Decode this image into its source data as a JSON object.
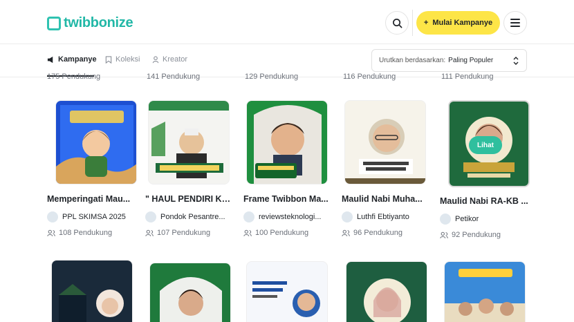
{
  "brand": {
    "name": "twibbonize"
  },
  "header": {
    "cta_label": "Mulai Kampanye",
    "cta_icon": "plus-icon",
    "search_icon": "search-icon",
    "menu_icon": "hamburger-icon"
  },
  "tabs": [
    {
      "label": "Kampanye",
      "icon": "megaphone-icon",
      "active": true
    },
    {
      "label": "Koleksi",
      "icon": "bookmark-icon",
      "active": false
    },
    {
      "label": "Kreator",
      "icon": "person-icon",
      "active": false
    }
  ],
  "sort": {
    "label": "Urutkan berdasarkan:",
    "value": "Paling Populer"
  },
  "cut_counts": [
    "175 Pendukung",
    "141 Pendukung",
    "129 Pendukung",
    "116 Pendukung",
    "111 Pendukung"
  ],
  "cards_row1": [
    {
      "title": "Memperingati Mau...",
      "author": "PPL SKIMSA 2025",
      "supporters": "108 Pendukung"
    },
    {
      "title": "\" HAUL PENDIRI KE ...",
      "author": "Pondok Pesantre...",
      "supporters": "107 Pendukung"
    },
    {
      "title": "Frame Twibbon Ma...",
      "author": "reviewsteknologi...",
      "supporters": "100 Pendukung"
    },
    {
      "title": "Maulid Nabi Muha...",
      "author": "Luthfi Ebtiyanto",
      "supporters": "96 Pendukung"
    },
    {
      "title": "Maulid Nabi RA-KB ...",
      "author": "Petikor",
      "supporters": "92 Pendukung",
      "hover_label": "Lihat"
    }
  ],
  "cards_row2_count": 5,
  "colors": {
    "accent": "#22b8a7",
    "cta": "#fde547",
    "hover": "#2fbf9e"
  }
}
